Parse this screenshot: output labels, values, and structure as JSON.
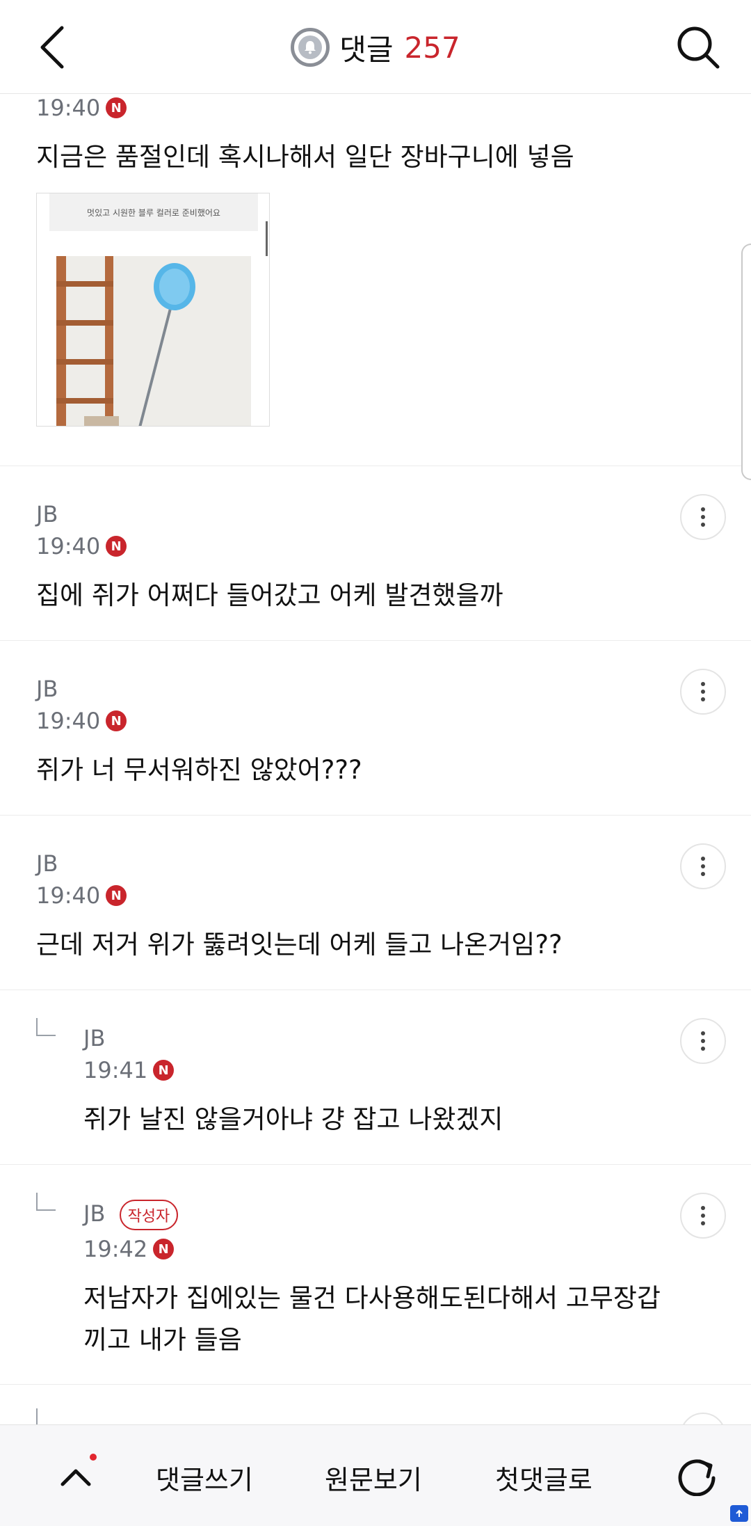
{
  "header": {
    "title": "댓글",
    "count": "257",
    "icons": {
      "back": "chevron-left-icon",
      "bell": "bell-icon",
      "search": "search-icon"
    }
  },
  "comments": [
    {
      "time": "19:40",
      "badge": "N",
      "text": "지금은 품절인데 혹시나해서 일단 장바구니에 넣음",
      "image_caption": "멋있고 시원한 블루 컬러로 준비했어요"
    },
    {
      "author": "JB",
      "time": "19:40",
      "badge": "N",
      "text": "집에 쥐가 어쩌다 들어갔고 어케 발견했을까"
    },
    {
      "author": "JB",
      "time": "19:40",
      "badge": "N",
      "text": "쥐가 너 무서워하진 않았어???"
    },
    {
      "author": "JB",
      "time": "19:40",
      "badge": "N",
      "text": "근데 저거 위가 뚫려잇는데 어케 들고 나온거임??"
    },
    {
      "author": "JB",
      "time": "19:41",
      "badge": "N",
      "text": "쥐가 날진 않을거아냐 걍 잡고 나왔겠지"
    },
    {
      "author": "JB",
      "author_badge": "작성자",
      "time": "19:42",
      "badge": "N",
      "text_line1": "저남자가 집에있는 물건 다사용해도된다해서 고무장갑",
      "text_line2": "끼고 내가 들음"
    }
  ],
  "bottom_bar": {
    "write": "댓글쓰기",
    "original": "원문보기",
    "first": "첫댓글로",
    "icons": {
      "up": "chevron-up-icon",
      "refresh": "refresh-icon"
    }
  },
  "colors": {
    "accent": "#c9252c",
    "meta": "#6b6f77"
  }
}
